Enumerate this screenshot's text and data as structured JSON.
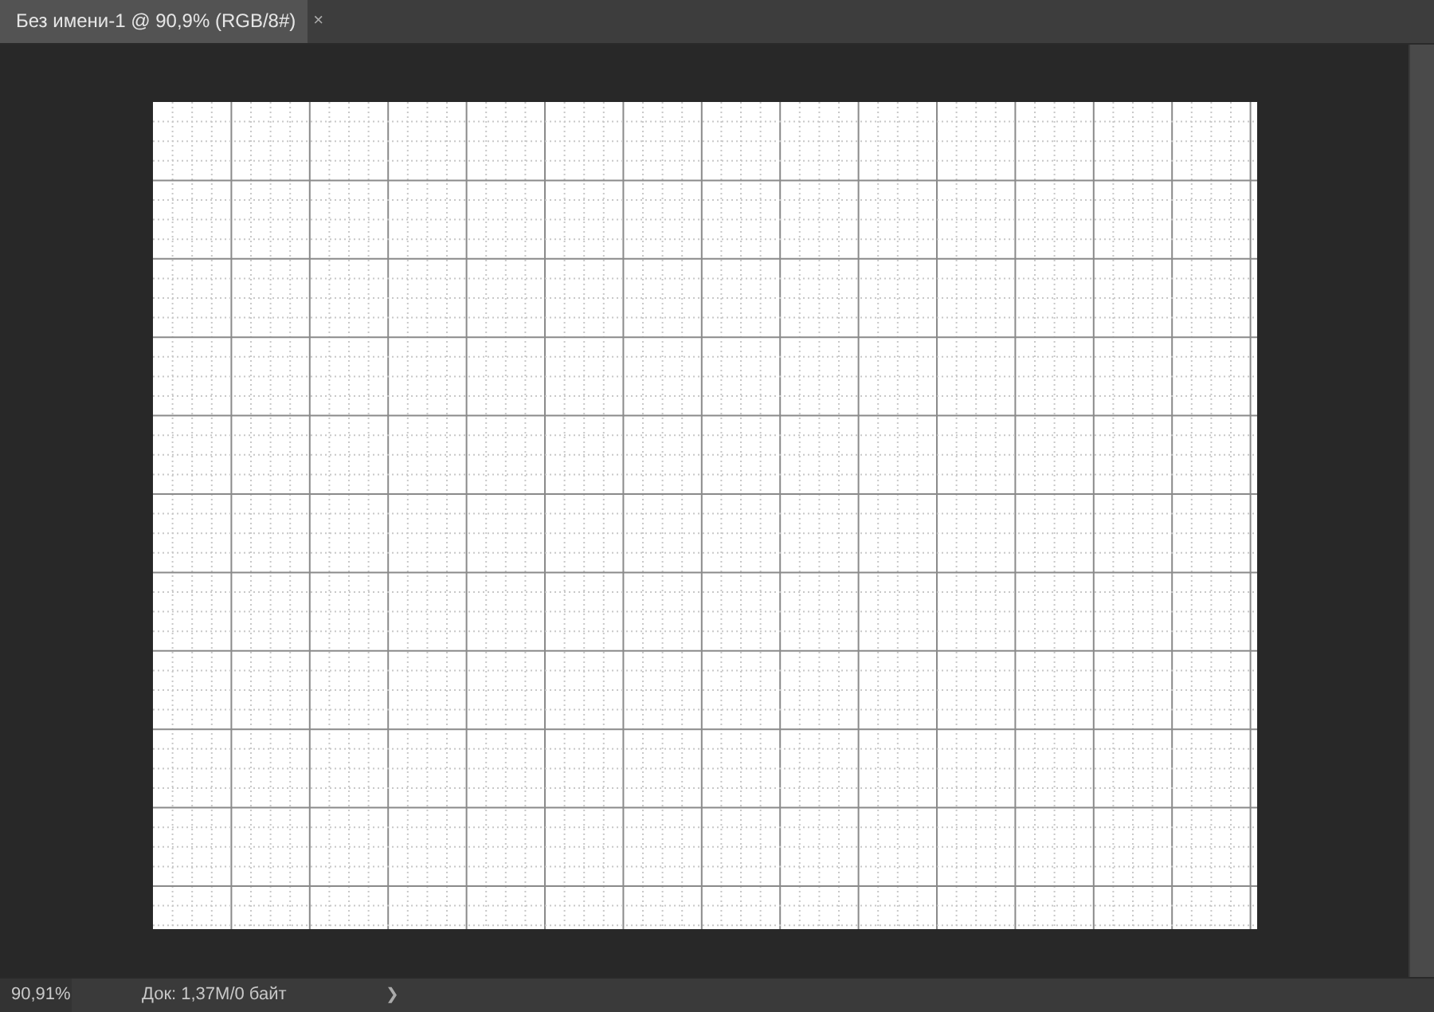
{
  "tabs": [
    {
      "label": "Без имени-1 @ 90,9% (RGB/8#)",
      "close": "×",
      "selected": true
    }
  ],
  "status_bar": {
    "zoom": "90,91%",
    "doc_info": "Док: 1,37M/0 байт",
    "arrow": "❯"
  }
}
